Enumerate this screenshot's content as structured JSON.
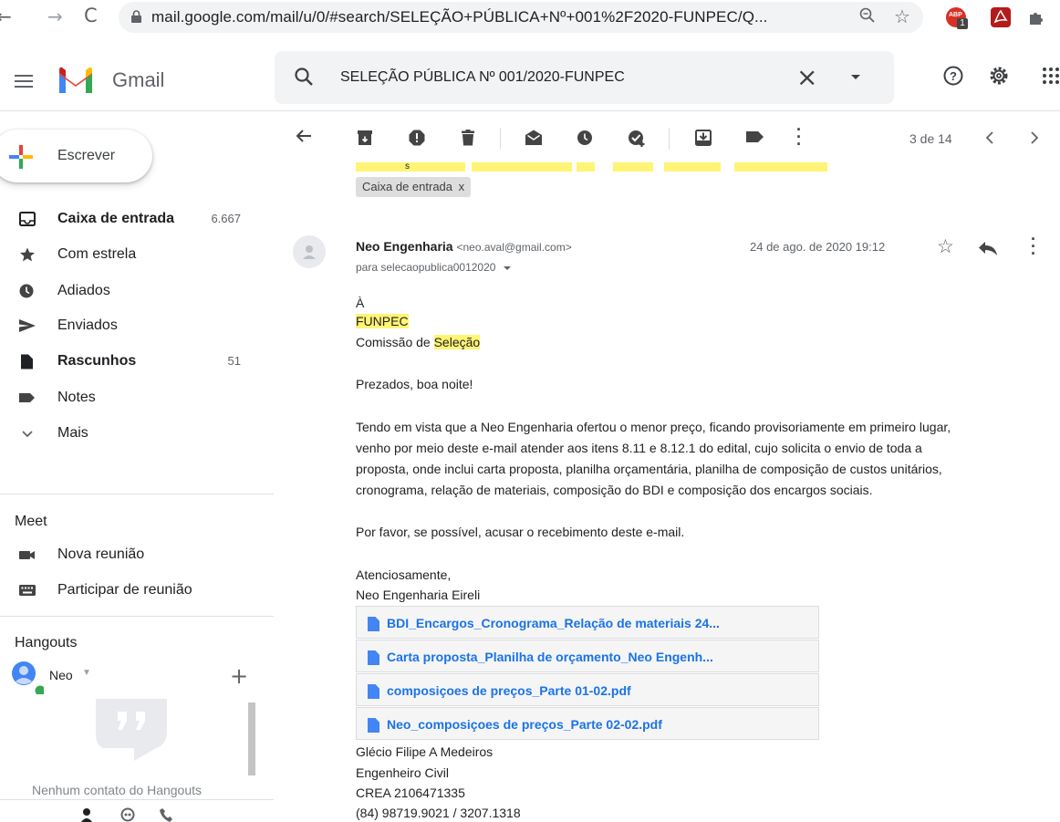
{
  "browser": {
    "url": "mail.google.com/mail/u/0/#search/SELEÇÃO+PÚBLICA+Nº+001%2F2020-FUNPEC/Q...",
    "badge": "1",
    "ext_label": "ABP"
  },
  "header": {
    "product": "Gmail",
    "search_value": "SELEÇÃO PÚBLICA Nº 001/2020-FUNPEC"
  },
  "sidebar": {
    "compose_label": "Escrever",
    "items": [
      {
        "label": "Caixa de entrada",
        "count": "6.667",
        "bold": true,
        "icon": "inbox-icon"
      },
      {
        "label": "Com estrela",
        "count": "",
        "bold": false,
        "icon": "star-icon"
      },
      {
        "label": "Adiados",
        "count": "",
        "bold": false,
        "icon": "clock-icon"
      },
      {
        "label": "Enviados",
        "count": "",
        "bold": false,
        "icon": "send-icon"
      },
      {
        "label": "Rascunhos",
        "count": "51",
        "bold": true,
        "icon": "draft-icon"
      },
      {
        "label": "Notes",
        "count": "",
        "bold": false,
        "icon": "label-icon"
      },
      {
        "label": "Mais",
        "count": "",
        "bold": false,
        "icon": "chevron-down-icon"
      }
    ],
    "meet": {
      "title": "Meet",
      "items": [
        {
          "label": "Nova reunião",
          "icon": "video-icon"
        },
        {
          "label": "Participar de reunião",
          "icon": "keyboard-icon"
        }
      ]
    },
    "hangouts": {
      "title": "Hangouts",
      "user": "Neo",
      "empty_text": "Nenhum contato do Hangouts"
    }
  },
  "toolbar": {
    "pager": "3 de 14"
  },
  "message": {
    "label_chip": "Caixa de entrada",
    "label_chip_close": "x",
    "sender_name": "Neo Engenharia",
    "sender_email": "<neo.aval@gmail.com>",
    "recipient": "para selecaopublica0012020",
    "date": "24 de ago. de 2020 19:12",
    "greeting_line": "À",
    "org": "FUNPEC",
    "committee_prefix": "Comissão de ",
    "committee_highlight": "Seleção",
    "salutation": "Prezados, boa noite!",
    "paragraph": [
      "Tendo em vista que a Neo Engenharia ofertou o menor preço, ficando provisoriamente em primeiro lugar,",
      "venho por meio deste e-mail atender aos itens 8.11 e 8.12.1 do edital, cujo solicita o envio de toda a",
      "proposta, onde inclui carta proposta, planilha orçamentária, planilha de composição de custos unitários,",
      "cronograma, relação de materiais, composição do BDI e composição dos encargos sociais."
    ],
    "request": "Por favor, se possível, acusar o recebimento deste e-mail.",
    "closing": "Atenciosamente,",
    "company": "Neo Engenharia Eireli",
    "attachments": [
      "BDI_Encargos_Cronograma_Relação de materiais 24...",
      "Carta proposta_Planilha de orçamento_Neo Engenh...",
      "composiçoes de preços_Parte 01-02.pdf",
      "Neo_composiçoes de preços_Parte 02-02.pdf"
    ],
    "signature": [
      "Glécio Filipe A Medeiros",
      "Engenheiro Civil",
      "CREA 2106471335",
      "(84) 98719.9021 / 3207.1318"
    ],
    "partial_above": "s"
  },
  "colors": {
    "highlight": "#fff475",
    "link": "#1a73e8",
    "gmail_red": "#ea4335",
    "gmail_blue": "#4285f4",
    "gmail_green": "#34a853",
    "gmail_yellow": "#fbbc04"
  }
}
